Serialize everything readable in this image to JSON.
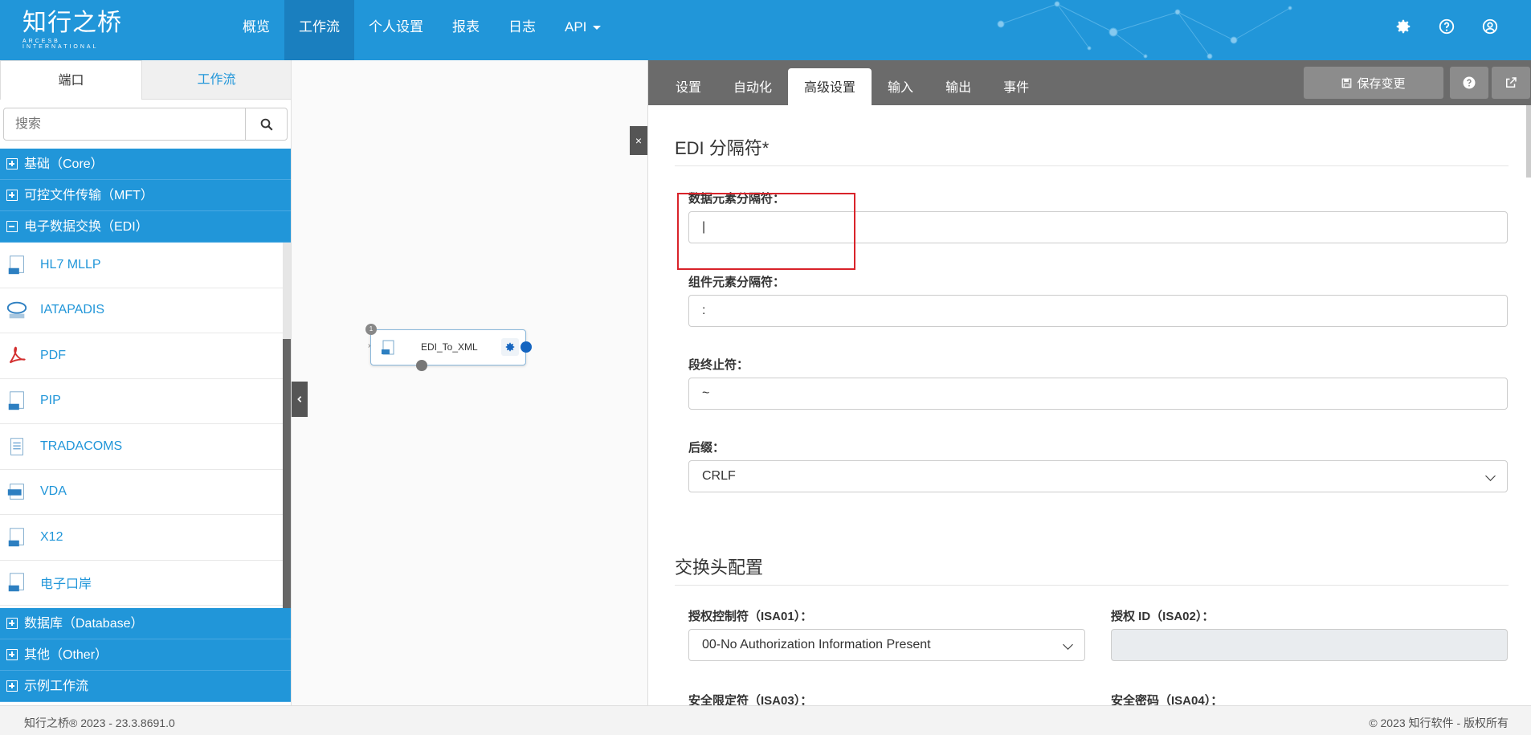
{
  "header": {
    "logo_cn": "知行之桥",
    "logo_en": "ARCESB INTERNATIONAL",
    "nav": [
      "概览",
      "工作流",
      "个人设置",
      "报表",
      "日志",
      "API"
    ],
    "active_nav": "工作流"
  },
  "left": {
    "tabs": [
      "端口",
      "工作流"
    ],
    "search_placeholder": "搜索",
    "categories_top": [
      "基础（Core）",
      "可控文件传输（MFT）",
      "电子数据交换（EDI）"
    ],
    "items": [
      "HL7 MLLP",
      "IATAPADIS",
      "PDF",
      "PIP",
      "TRADACOMS",
      "VDA",
      "X12",
      "电子口岸"
    ],
    "categories_bottom": [
      "数据库（Database）",
      "其他（Other）",
      "示例工作流"
    ]
  },
  "canvas": {
    "node_label": "EDI_To_XML",
    "node_badge": "1",
    "close_label": "×"
  },
  "right": {
    "tabs": [
      "设置",
      "自动化",
      "高级设置",
      "输入",
      "输出",
      "事件"
    ],
    "active_tab": "高级设置",
    "save_label": "保存变更",
    "edi_title": "EDI 分隔符*",
    "fields": {
      "data_element_label": "数据元素分隔符：",
      "data_element_value": "|",
      "component_label": "组件元素分隔符：",
      "component_value": ":",
      "segment_label": "段终止符：",
      "segment_value": "~",
      "suffix_label": "后缀：",
      "suffix_value": "CRLF"
    },
    "interchange_title": "交换头配置",
    "isa": {
      "isa01_label": "授权控制符（ISA01）：",
      "isa01_value": "00-No Authorization Information Present",
      "isa02_label": "授权 ID（ISA02）：",
      "isa02_value": "",
      "isa03_label": "安全限定符（ISA03）：",
      "isa04_label": "安全密码（ISA04）："
    }
  },
  "footer": {
    "left": "知行之桥® 2023 - 23.3.8691.0",
    "right": "© 2023 知行软件 - 版权所有"
  },
  "colors": {
    "primary": "#2196d9",
    "tabbar": "#6b6b6b",
    "highlight": "#d9232a"
  },
  "icons": [
    "gear-icon",
    "question-icon",
    "user-icon",
    "search-icon",
    "save-icon",
    "external-link-icon"
  ]
}
